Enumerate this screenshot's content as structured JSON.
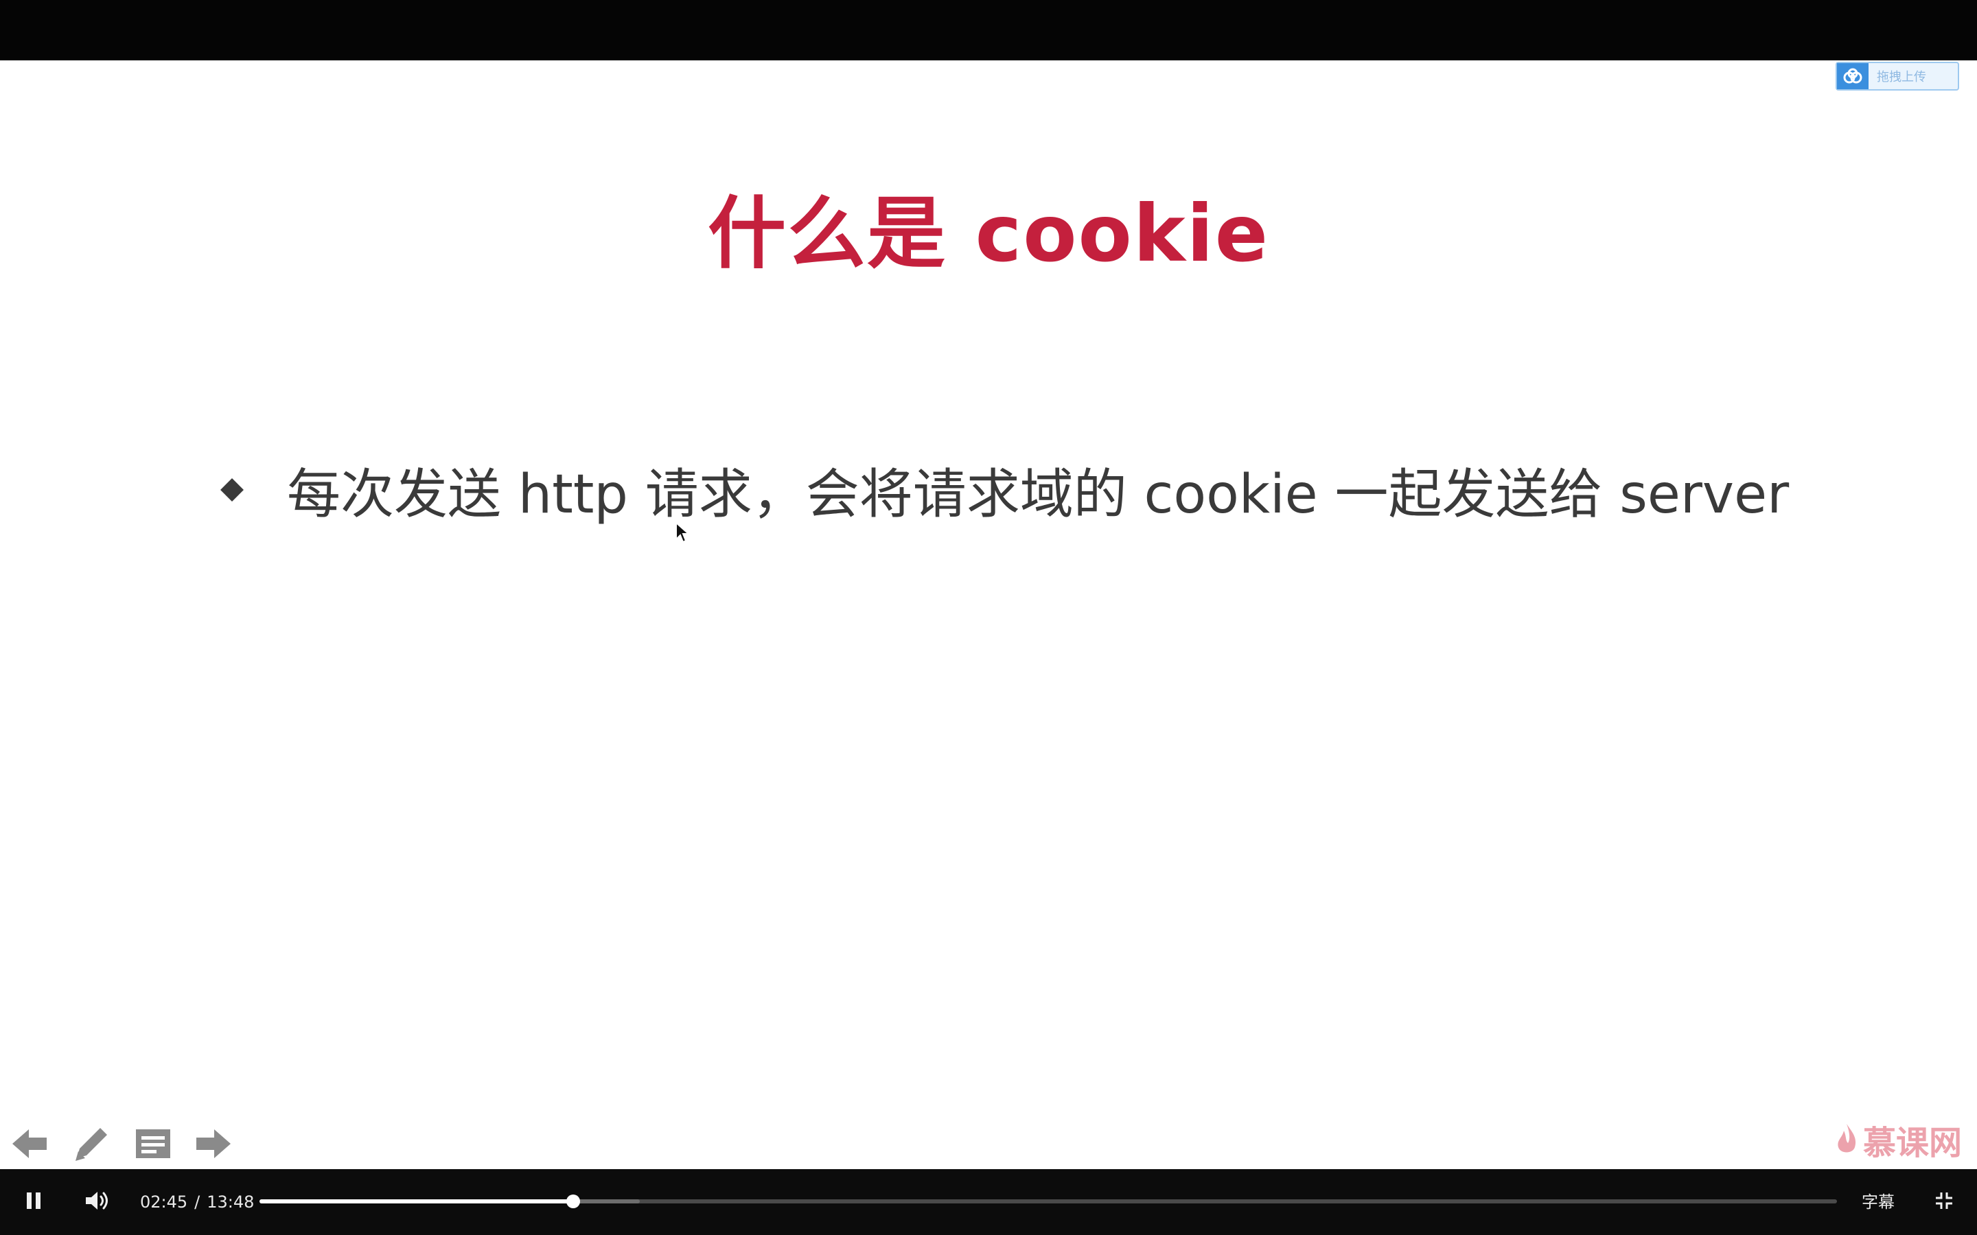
{
  "slide": {
    "title": "什么是 cookie",
    "bullets": [
      "每次发送 http 请求，会将请求域的 cookie 一起发送给 server"
    ],
    "upload_badge_label": "拖拽上传",
    "brand": "慕课网"
  },
  "player": {
    "current_time": "02:45",
    "separator": "/",
    "duration": "13:48",
    "progress_fraction": 0.199,
    "buffered_fraction": 0.241,
    "subtitle_label": "字幕"
  },
  "colors": {
    "title": "#c4203d",
    "body_text": "#3a3a3a",
    "control_bar": "#0c0c0c"
  },
  "icons": {
    "play_state": "pause-icon",
    "volume": "volume-icon",
    "exit_fullscreen": "exit-fullscreen-icon",
    "ppt_prev": "arrow-left-icon",
    "ppt_pen": "pen-icon",
    "ppt_notes": "notes-icon",
    "ppt_next": "arrow-right-icon"
  }
}
